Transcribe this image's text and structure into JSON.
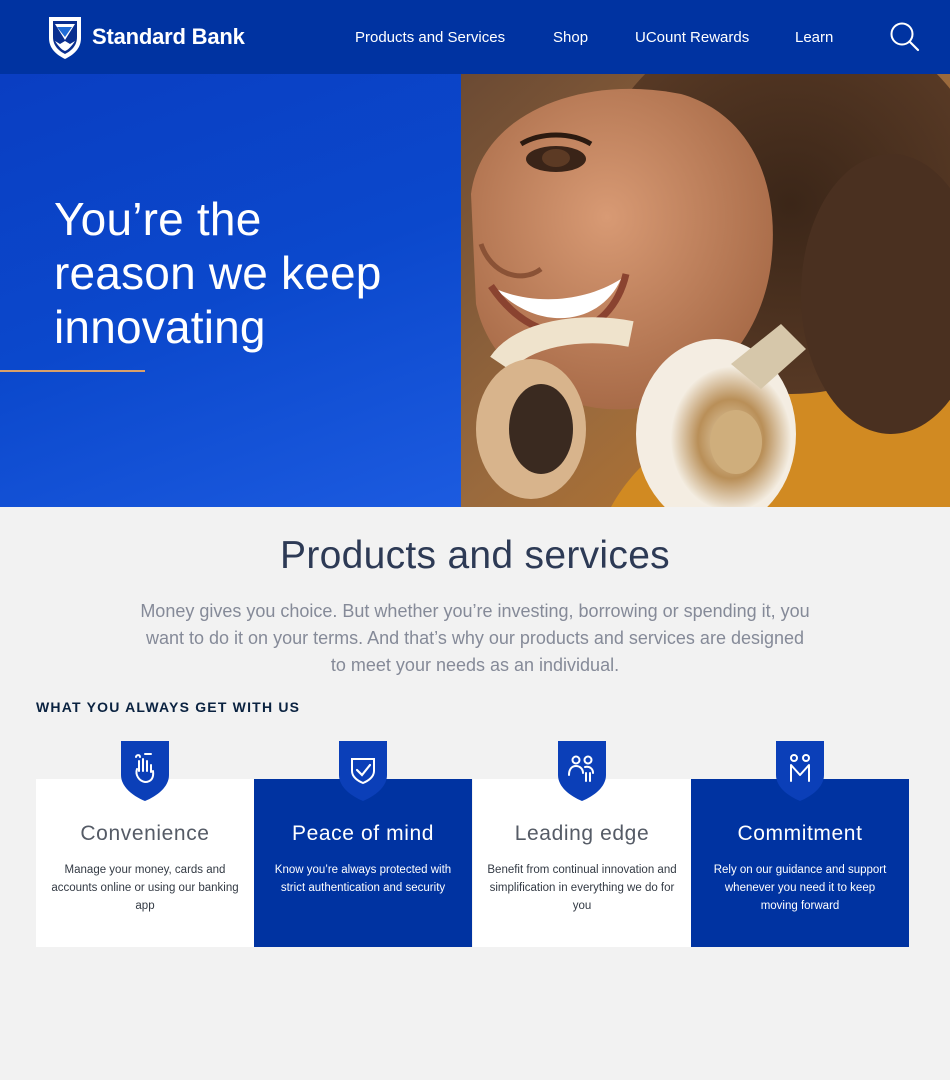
{
  "header": {
    "brand_name": "Standard Bank",
    "nav": [
      "Products and Services",
      "Shop",
      "UCount Rewards",
      "Learn"
    ]
  },
  "hero": {
    "title": "You’re the reason we keep innovating"
  },
  "products": {
    "title": "Products and services",
    "intro": "Money gives you choice. But whether you’re investing, borrowing or spending it, you want to do it on your terms. And that’s why our products and services are designed to meet your needs as an individual."
  },
  "benefits": {
    "heading": "WHAT YOU ALWAYS GET WITH US",
    "cards": [
      {
        "title": "Convenience",
        "text": "Manage your money, cards and accounts online or using our banking app",
        "icon": "hand-tap-icon"
      },
      {
        "title": "Peace of mind",
        "text": "Know you’re always protected with strict authentication and security",
        "icon": "shield-check-icon"
      },
      {
        "title": "Leading edge",
        "text": "Benefit from continual innovation and simplification in everything we do for you",
        "icon": "people-icon"
      },
      {
        "title": "Commitment",
        "text": "Rely on our guidance and support whenever you need it to keep moving forward",
        "icon": "commitment-icon"
      }
    ]
  },
  "colors": {
    "brand_blue": "#0033a1",
    "hero_blue": "#0b48cc",
    "accent_orange": "#d9a06a",
    "page_bg": "#f2f2f2"
  }
}
